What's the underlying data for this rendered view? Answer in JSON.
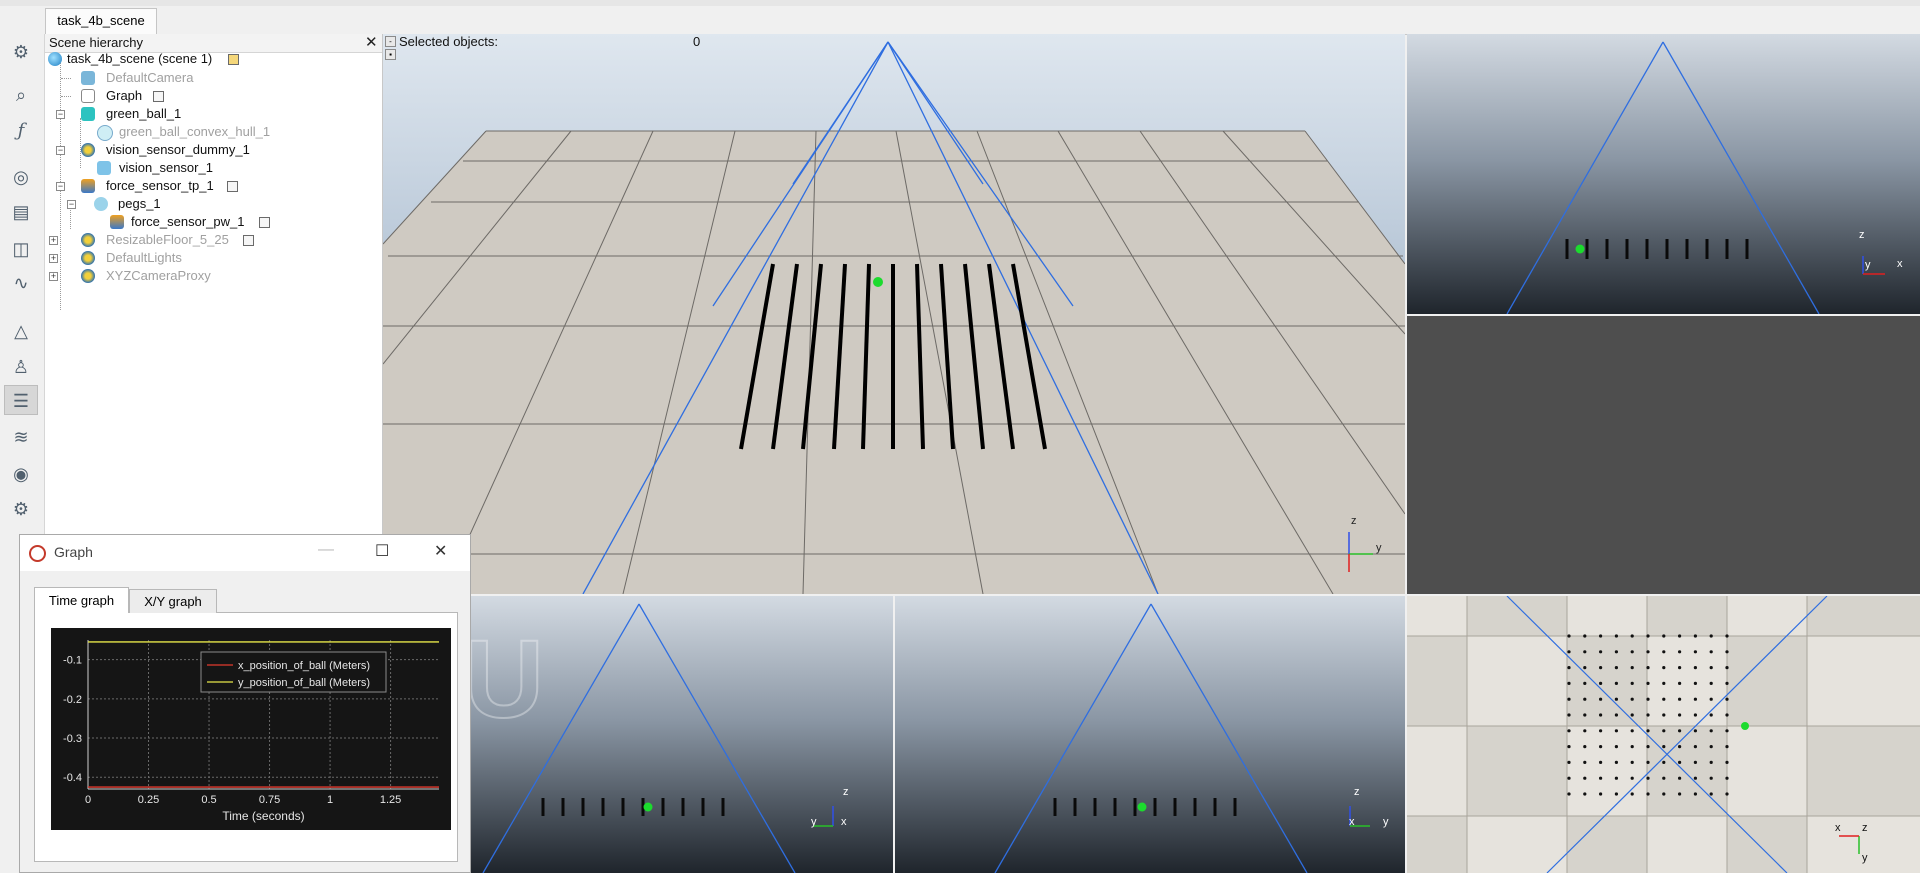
{
  "tab_bar": {
    "scene_tab": "task_4b_scene"
  },
  "toolbar": {
    "icons": [
      "simulation-settings-icon",
      "zoom-icon",
      "function-icon",
      "calculation-modules-icon",
      "scripts-icon",
      "shapes-icon",
      "paths-icon",
      "object-properties-icon",
      "model-browser-icon",
      "scene-hierarchy-icon",
      "layers-icon",
      "video-recorder-icon",
      "user-settings-icon"
    ]
  },
  "hierarchy": {
    "title": "Scene hierarchy",
    "close": "✕",
    "items": [
      {
        "label": "task_4b_scene (scene 1)",
        "dim": false,
        "icon": "scene-icon"
      },
      {
        "label": "DefaultCamera",
        "dim": true,
        "icon": "camera-icon"
      },
      {
        "label": "Graph",
        "dim": false,
        "icon": "graph-icon"
      },
      {
        "label": "green_ball_1",
        "dim": false,
        "icon": "shape-icon"
      },
      {
        "label": "green_ball_convex_hull_1",
        "dim": true,
        "icon": "convex-shape-icon"
      },
      {
        "label": "vision_sensor_dummy_1",
        "dim": false,
        "icon": "model-icon"
      },
      {
        "label": "vision_sensor_1",
        "dim": false,
        "icon": "vision-sensor-icon"
      },
      {
        "label": "force_sensor_tp_1",
        "dim": false,
        "icon": "force-sensor-icon"
      },
      {
        "label": "pegs_1",
        "dim": false,
        "icon": "shape-group-icon"
      },
      {
        "label": "force_sensor_pw_1",
        "dim": false,
        "icon": "force-sensor-icon"
      },
      {
        "label": "ResizableFloor_5_25",
        "dim": true,
        "icon": "model-icon"
      },
      {
        "label": "DefaultLights",
        "dim": true,
        "icon": "model-icon"
      },
      {
        "label": "XYZCameraProxy",
        "dim": true,
        "icon": "model-icon"
      }
    ]
  },
  "main_view": {
    "selected_label": "Selected objects:",
    "selected_value": "0"
  },
  "axes": {
    "x": "x",
    "y": "y",
    "z": "z"
  },
  "graph_window": {
    "title": "Graph",
    "tabs": [
      "Time graph",
      "X/Y graph"
    ],
    "controls": {
      "minimize": "—",
      "maximize": "☐",
      "close": "✕"
    },
    "watermark": "DU"
  },
  "chart_data": {
    "type": "line",
    "xlabel": "Time (seconds)",
    "ylabel": "",
    "xlim": [
      0,
      1.45
    ],
    "ylim": [
      -0.43,
      -0.05
    ],
    "xticks": [
      "0",
      "0.25",
      "0.5",
      "0.75",
      "1",
      "1.25"
    ],
    "yticks": [
      "-0.1",
      "-0.2",
      "-0.3",
      "-0.4"
    ],
    "grid": true,
    "legend_position": "top-right",
    "series": [
      {
        "name": "x_position_of_ball (Meters)",
        "color": "#e23a2f",
        "x": [
          0,
          0.25,
          0.5,
          0.75,
          1,
          1.25,
          1.45
        ],
        "values": [
          -0.425,
          -0.425,
          -0.425,
          -0.425,
          -0.425,
          -0.425,
          -0.425
        ]
      },
      {
        "name": "y_position_of_ball (Meters)",
        "color": "#e8e84a",
        "x": [
          0,
          0.25,
          0.5,
          0.75,
          1,
          1.25,
          1.45
        ],
        "values": [
          -0.055,
          -0.055,
          -0.055,
          -0.055,
          -0.055,
          -0.055,
          -0.055
        ]
      }
    ]
  }
}
